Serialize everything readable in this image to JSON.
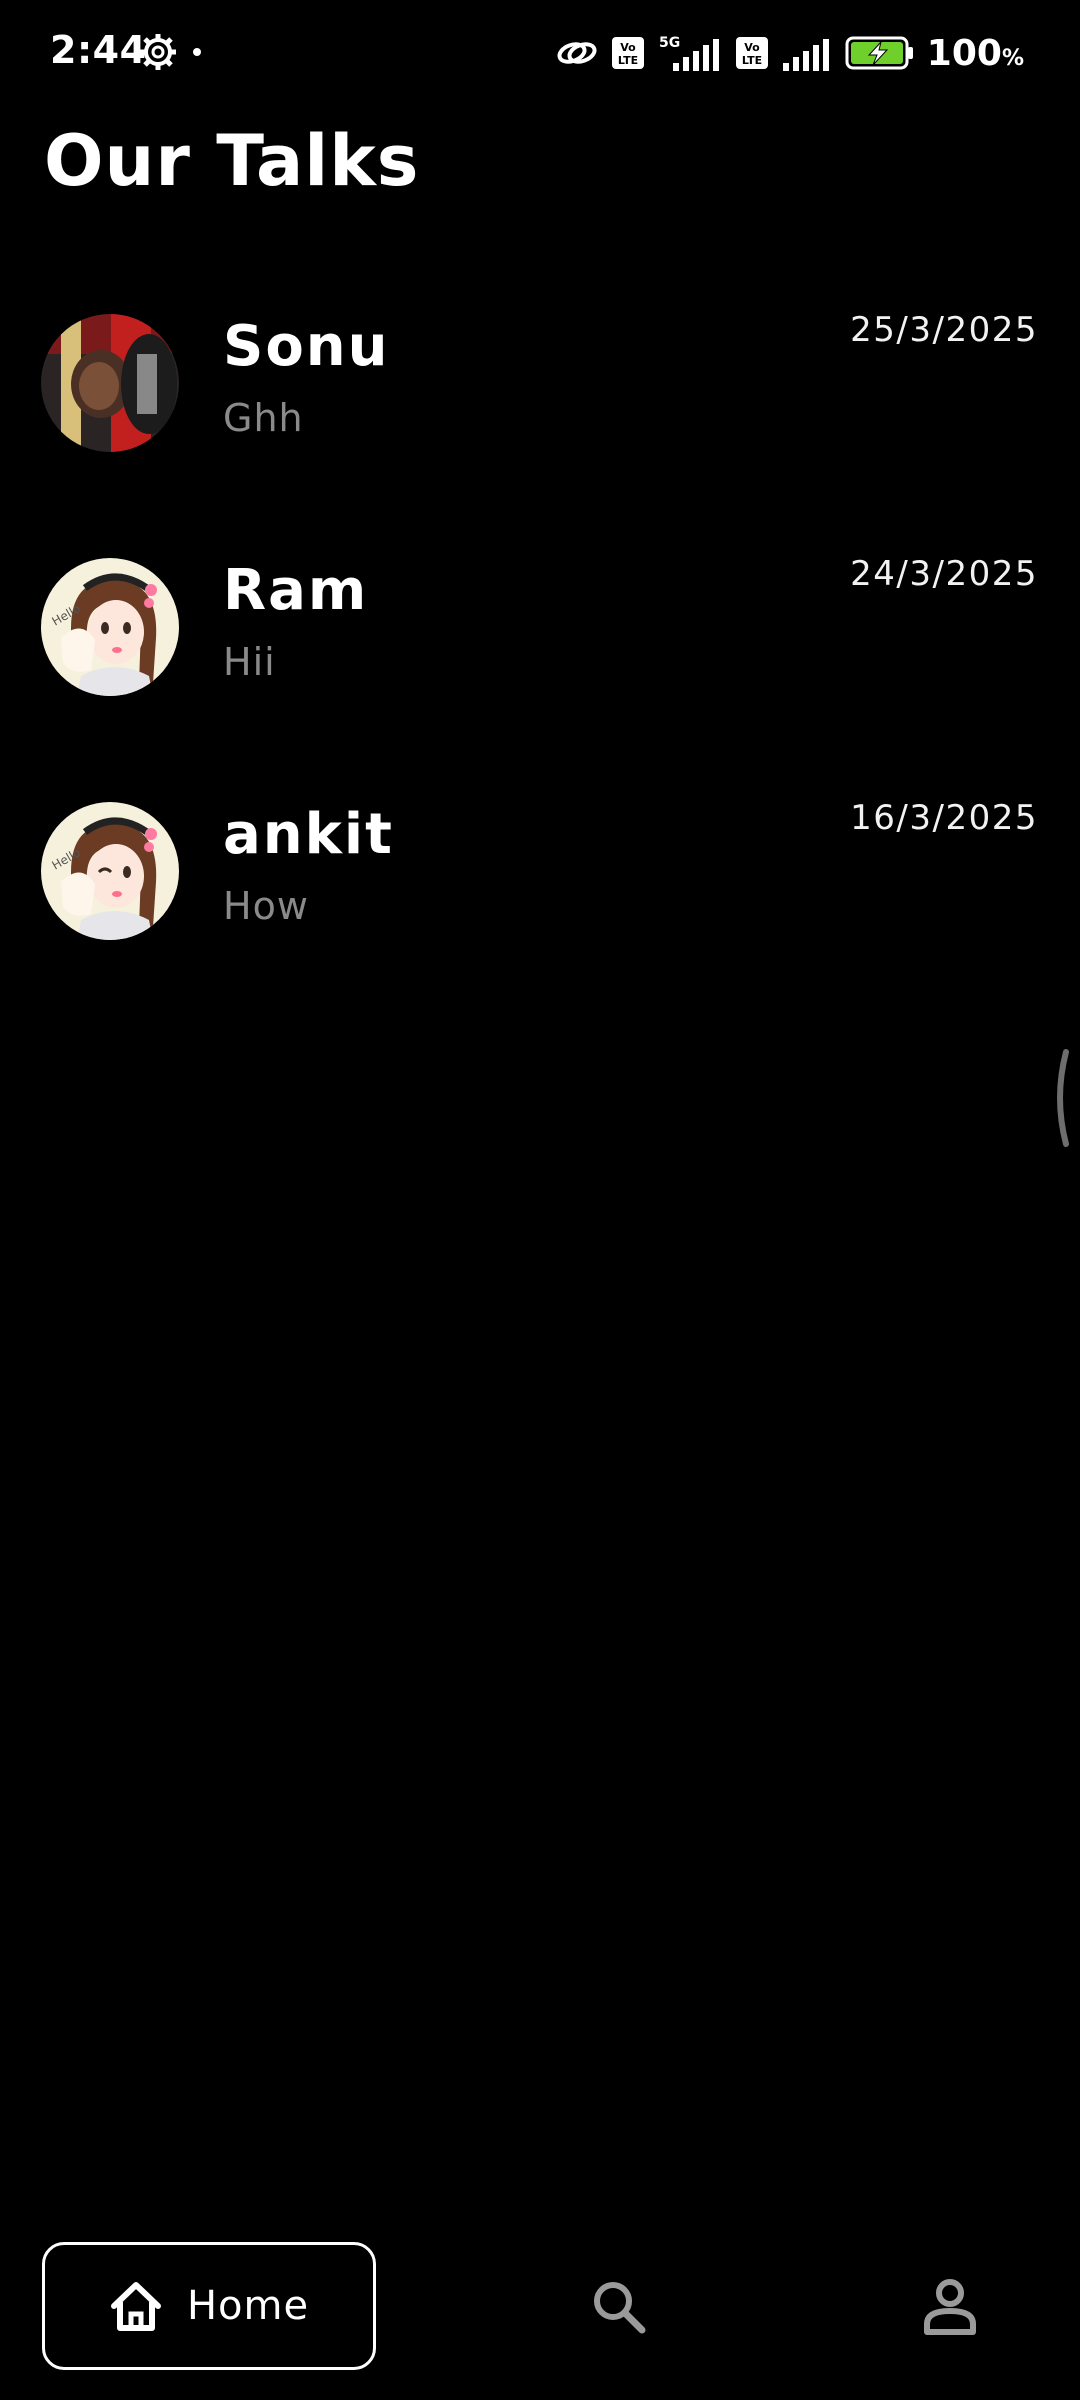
{
  "status_bar": {
    "time": "2:44",
    "battery_percent": "100",
    "battery_percent_sign": "%",
    "network_label": "5G",
    "volte_label_1": "Vo LTE",
    "volte_label_2": "Vo LTE",
    "icons": [
      "settings-gear-icon",
      "notification-dot-icon",
      "link-icon",
      "volte-icon",
      "signal-5g-icon",
      "volte-icon",
      "signal-icon",
      "battery-charging-icon"
    ]
  },
  "page": {
    "title": "Our Talks"
  },
  "chats": [
    {
      "name": "Sonu",
      "preview": "Ghh",
      "date": "25/3/2025",
      "avatar": "photo-avatar"
    },
    {
      "name": "Ram",
      "preview": "Hii",
      "date": "24/3/2025",
      "avatar": "cartoon-girl-avatar"
    },
    {
      "name": "ankit",
      "preview": "How",
      "date": "16/3/2025",
      "avatar": "cartoon-girl-avatar"
    }
  ],
  "bottom_nav": {
    "home_label": "Home",
    "items": [
      "home-icon",
      "search-icon",
      "profile-icon"
    ]
  },
  "colors": {
    "background": "#000000",
    "text_primary": "#ffffff",
    "text_secondary": "#8a8a8a",
    "battery_green": "#6fd02b"
  }
}
